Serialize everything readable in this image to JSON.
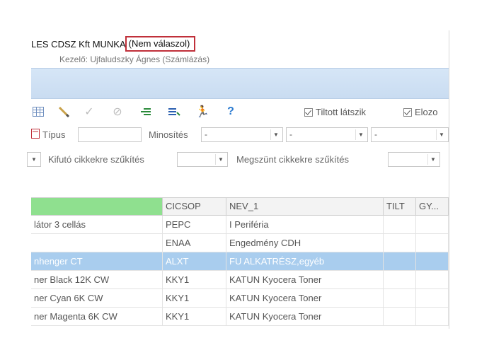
{
  "window": {
    "title": "LES CDSZ Kft MUNKA",
    "status": "(Nem válaszol)",
    "operator": "Kezelő: Ujfaludszky Ágnes  (Számlázás)"
  },
  "toolbar": {
    "icons": [
      "grid-icon",
      "pencil-icon",
      "check-icon",
      "cancel-icon",
      "list-indent-icon",
      "list-filter-icon",
      "person-icon",
      "help-icon"
    ],
    "checkbox_tiltott": "Tiltott látszik",
    "checkbox_elozo": "Elozo"
  },
  "filters": {
    "tipus_label": "Típus",
    "minosites_label": "Minosítés",
    "minosites_value": "-",
    "select2_value": "-",
    "select3_value": "-",
    "kifuto_label": "Kifutó cikkekre szűkítés",
    "megszunt_label": "Megszünt cikkekre szűkítés"
  },
  "grid": {
    "columns": [
      "",
      "CICSOP",
      "NEV_1",
      "TILT",
      "GY..."
    ],
    "rows": [
      [
        "látor 3 cellás",
        "PEPC",
        "I Periféria",
        "",
        ""
      ],
      [
        "",
        "ENAA",
        "Engedmény CDH",
        "",
        ""
      ],
      [
        "nhenger CT",
        "ALXT",
        "FU ALKATRÉSZ,egyéb",
        "",
        ""
      ],
      [
        "ner Black 12K CW",
        "KKY1",
        "KATUN Kyocera Toner",
        "",
        ""
      ],
      [
        "ner Cyan 6K CW",
        "KKY1",
        "KATUN Kyocera Toner",
        "",
        ""
      ],
      [
        "ner Magenta 6K CW",
        "KKY1",
        "KATUN Kyocera Toner",
        "",
        ""
      ]
    ],
    "selected_row": 2
  },
  "colors": {
    "status_border": "#c0303a",
    "selection": "#a9cdee",
    "highlight_header": "#8fe08f"
  }
}
